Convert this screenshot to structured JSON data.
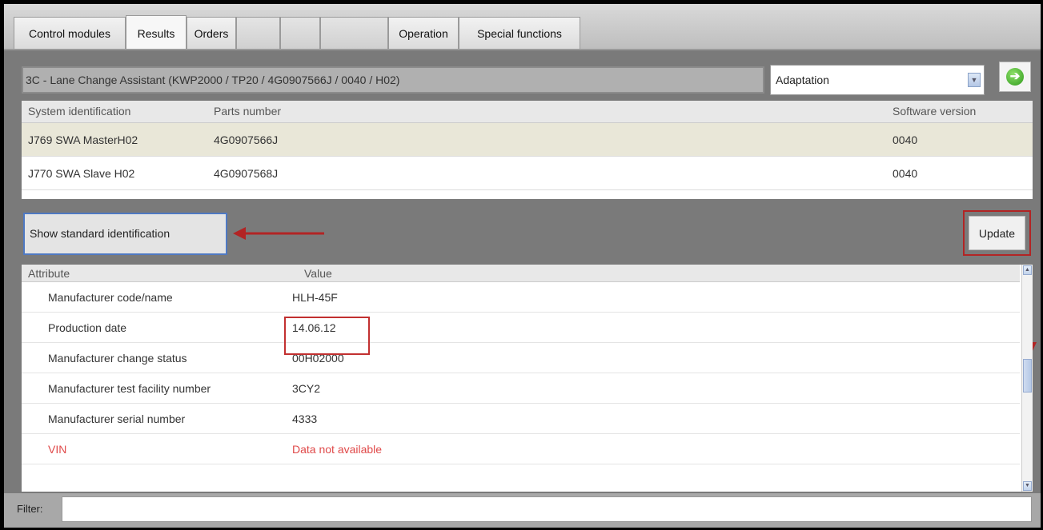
{
  "tabs": [
    {
      "label": "Control modules"
    },
    {
      "label": "Results"
    },
    {
      "label": "Orders"
    },
    {
      "label": "Operation"
    },
    {
      "label": "Special functions"
    }
  ],
  "module": {
    "title": "3C - Lane Change Assistant  (KWP2000 / TP20 / 4G0907566J   / 0040 / H02)"
  },
  "function_select": {
    "value": "Adaptation"
  },
  "ident_table": {
    "columns": [
      "System identification",
      "Parts number",
      "Software version"
    ],
    "rows": [
      {
        "system": "J769  SWA MasterH02",
        "parts": "4G0907566J",
        "software": "0040"
      },
      {
        "system": "J770  SWA Slave H02",
        "parts": "4G0907568J",
        "software": "0040"
      }
    ]
  },
  "buttons": {
    "show_standard": "Show standard identification",
    "update": "Update"
  },
  "attr_table": {
    "columns": [
      "Attribute",
      "Value"
    ],
    "rows": [
      {
        "attr": "Manufacturer code/name",
        "value": "HLH-45F"
      },
      {
        "attr": "Production date",
        "value": "14.06.12"
      },
      {
        "attr": "Manufacturer change status",
        "value": "00H02000"
      },
      {
        "attr": "Manufacturer test facility number",
        "value": "3CY2"
      },
      {
        "attr": "Manufacturer serial number",
        "value": "4333"
      },
      {
        "attr": "VIN",
        "value": "Data not available"
      }
    ]
  },
  "filter": {
    "label": "Filter:",
    "value": ""
  },
  "colors": {
    "annotation_red": "#b22424",
    "highlight_blue": "#4f79c2",
    "not_available_red": "#e04a4a"
  },
  "icons": [
    "go-arrow-icon",
    "chevron-down-icon",
    "scroll-up-icon",
    "scroll-down-icon"
  ]
}
